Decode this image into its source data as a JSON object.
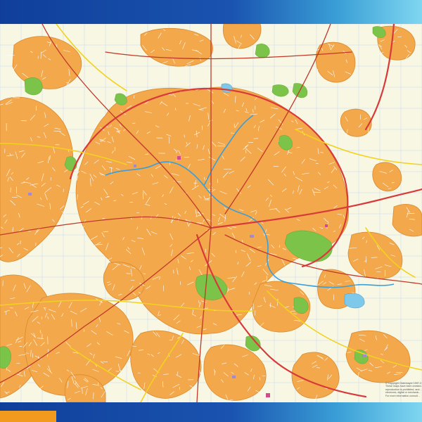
{
  "map": {
    "colors": {
      "background": "#f7f7e4",
      "urban": "#f3a84b",
      "urban_edge": "#d98a2e",
      "park": "#7cc34a",
      "water": "#7ec8ea",
      "river": "#3b9fd9",
      "grid": "#c8d7f0",
      "motorway": "#d83a3a",
      "main_road": "#c0392b",
      "minor_road": "#f2d21f",
      "street": "#ffffff",
      "frame": "#1a54b0",
      "accent_tab": "#f29a1e"
    }
  },
  "copyright": {
    "lines": [
      "© Copyright Ostermayer 1997-2...",
      "These maps have been created...",
      "reproduction is prohibited, and...",
      "electronic, digital or mechanic...",
      "For more information consult..."
    ]
  }
}
